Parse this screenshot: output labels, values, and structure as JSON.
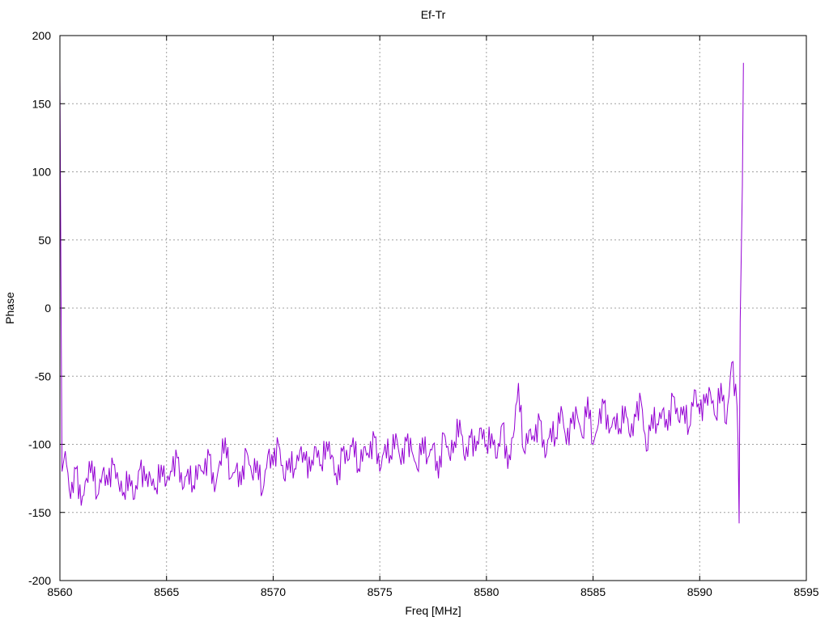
{
  "chart_data": {
    "type": "line",
    "title": "Ef-Tr",
    "xlabel": "Freq [MHz]",
    "ylabel": "Phase",
    "xlim": [
      8560,
      8595
    ],
    "ylim": [
      -200,
      200
    ],
    "xticks": [
      8560,
      8565,
      8570,
      8575,
      8580,
      8585,
      8590,
      8595
    ],
    "yticks": [
      -200,
      -150,
      -100,
      -50,
      0,
      50,
      100,
      150,
      200
    ],
    "grid": true,
    "legend": "none",
    "color": "#9400d3",
    "series": [
      {
        "name": "Ef-Tr",
        "head": [
          [
            8560.0,
            170
          ],
          [
            8560.05,
            20
          ],
          [
            8560.1,
            -120
          ]
        ],
        "x_start": 8560.25,
        "x_step": 0.25,
        "y": [
          -105,
          -140,
          -118,
          -145,
          -125,
          -112,
          -138,
          -120,
          -130,
          -115,
          -128,
          -135,
          -122,
          -140,
          -118,
          -127,
          -125,
          -132,
          -115,
          -128,
          -120,
          -110,
          -133,
          -118,
          -130,
          -115,
          -122,
          -108,
          -135,
          -112,
          -95,
          -125,
          -118,
          -130,
          -105,
          -122,
          -112,
          -135,
          -108,
          -115,
          -100,
          -125,
          -110,
          -118,
          -105,
          -112,
          -120,
          -102,
          -115,
          -98,
          -108,
          -130,
          -105,
          -112,
          -95,
          -118,
          -102,
          -110,
          -95,
          -120,
          -100,
          -108,
          -92,
          -115,
          -98,
          -105,
          -118,
          -95,
          -110,
          -100,
          -125,
          -92,
          -108,
          -98,
          -82,
          -112,
          -95,
          -105,
          -88,
          -100,
          -92,
          -110,
          -85,
          -118,
          -95,
          -55,
          -105,
          -90,
          -98,
          -82,
          -110,
          -88,
          -95,
          -72,
          -100,
          -85,
          -78,
          -95,
          -65,
          -100,
          -85,
          -70,
          -92,
          -80,
          -88,
          -72,
          -95,
          -80,
          -68,
          -105,
          -78,
          -85,
          -75,
          -90,
          -65,
          -82,
          -72,
          -88,
          -60,
          -78,
          -70,
          -62,
          -80,
          -55,
          -85,
          -40,
          -72
        ],
        "tail": [
          [
            8591.8,
            -100
          ],
          [
            8591.85,
            -158
          ],
          [
            8591.9,
            -10
          ],
          [
            8592.0,
            90
          ],
          [
            8592.05,
            180
          ]
        ]
      }
    ]
  }
}
